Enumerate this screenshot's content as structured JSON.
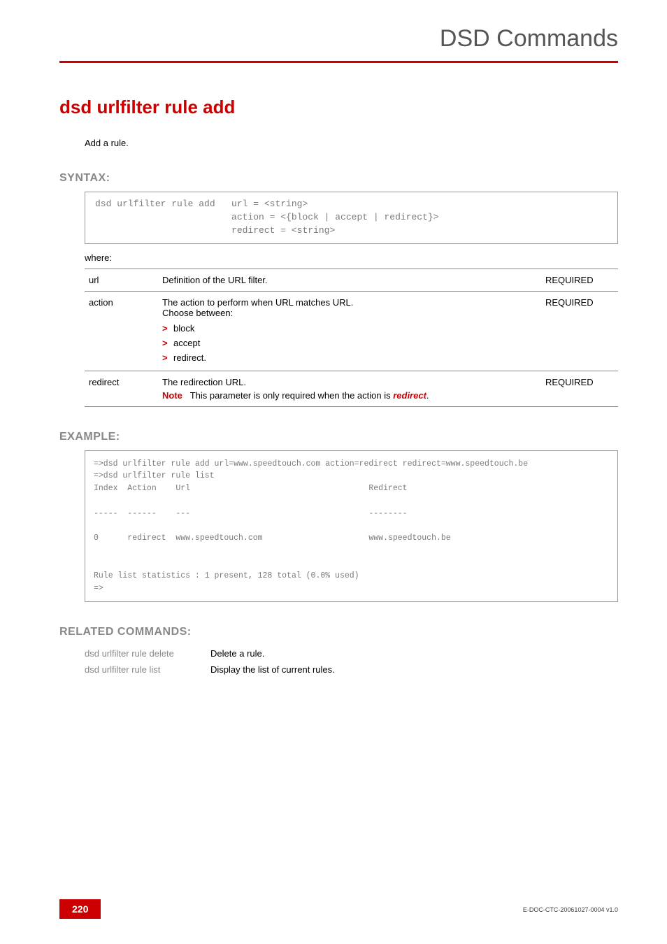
{
  "header": {
    "title": "DSD Commands"
  },
  "command": {
    "title": "dsd urlfilter rule add",
    "intro": "Add a rule."
  },
  "syntax": {
    "heading": "SYNTAX:",
    "text": "dsd urlfilter rule add   url = <string>\n                         action = <{block | accept | redirect}>\n                         redirect = <string>",
    "where": "where:"
  },
  "params": {
    "url": {
      "name": "url",
      "desc": "Definition of the URL filter.",
      "req": "REQUIRED"
    },
    "action": {
      "name": "action",
      "desc_line1": "The action to perform when URL matches URL.",
      "desc_line2": "Choose between:",
      "opt1": "block",
      "opt2": "accept",
      "opt3": "redirect.",
      "req": "REQUIRED"
    },
    "redirect": {
      "name": "redirect",
      "desc": "The redirection URL.",
      "note_label": "Note",
      "note_text_pre": "This parameter is only required when the action is ",
      "note_text_em": "redirect",
      "note_text_post": ".",
      "req": "REQUIRED"
    }
  },
  "example": {
    "heading": "EXAMPLE:",
    "text": "=>dsd urlfilter rule add url=www.speedtouch.com action=redirect redirect=www.speedtouch.be\n=>dsd urlfilter rule list\nIndex  Action    Url                                     Redirect\n\n-----  ------    ---                                     --------\n\n0      redirect  www.speedtouch.com                      www.speedtouch.be\n\n\nRule list statistics : 1 present, 128 total (0.0% used)\n=>"
  },
  "related": {
    "heading": "RELATED COMMANDS:",
    "rows": [
      {
        "cmd": "dsd urlfilter rule delete",
        "desc": "Delete a rule."
      },
      {
        "cmd": "dsd urlfilter rule list",
        "desc": "Display the list of current rules."
      }
    ]
  },
  "footer": {
    "page": "220",
    "docid": "E-DOC-CTC-20061027-0004 v1.0"
  }
}
